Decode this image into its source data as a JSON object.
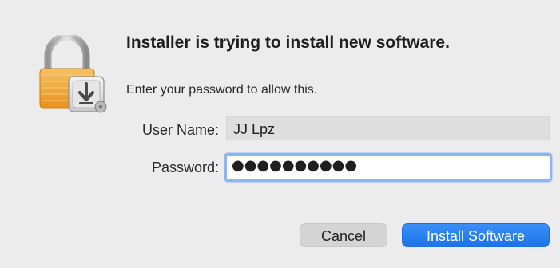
{
  "dialog": {
    "title": "Installer is trying to install new software.",
    "message": "Enter your password to allow this.",
    "user_name_label": "User Name:",
    "user_name_value": "JJ Lpz",
    "password_label": "Password:",
    "password_masked": "●●●●●●●●●●",
    "cancel_label": "Cancel",
    "install_label": "Install Software"
  },
  "colors": {
    "accent": "#1a74ec",
    "focus_ring": "#8fb4f0",
    "lock_body": "#f0a23b"
  },
  "icons": {
    "main": "lock-with-installer-icon"
  }
}
